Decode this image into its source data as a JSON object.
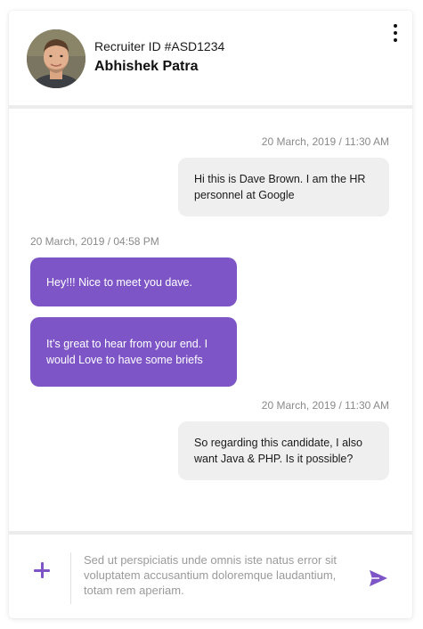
{
  "header": {
    "recruiter_id": "Recruiter ID #ASD1234",
    "name": "Abhishek Patra",
    "avatar_icon": "user-avatar-photo",
    "menu_icon": "more-vertical-icon"
  },
  "messages": [
    {
      "direction": "outgoing",
      "timestamp": "20 March, 2019 / 11:30 AM",
      "text": "Hi this is Dave Brown. I am the HR personnel at Google"
    },
    {
      "direction": "incoming",
      "timestamp": "20 March, 2019 / 04:58 PM",
      "text": "Hey!!! Nice to meet you dave."
    },
    {
      "direction": "incoming",
      "timestamp": "",
      "text": "It’s great to hear from your end. I would Love to have some briefs"
    },
    {
      "direction": "outgoing",
      "timestamp": "20 March, 2019 / 11:30 AM",
      "text": "So regarding this candidate, I also want Java & PHP. Is it possible?"
    }
  ],
  "composer": {
    "placeholder": "Sed ut perspiciatis unde omnis iste natus error sit voluptatem accusantium doloremque laudantium, totam rem aperiam.",
    "value": "",
    "add_icon": "plus-icon",
    "send_icon": "send-icon"
  },
  "colors": {
    "accent": "#7d55c7",
    "incoming_bubble": "#7d55c7",
    "outgoing_bubble": "#efefef",
    "timestamp": "#8a8a8a",
    "divider": "#ececec"
  }
}
